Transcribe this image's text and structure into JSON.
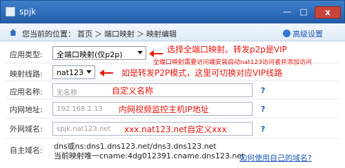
{
  "window": {
    "title": "spjk",
    "min_glyph": "—",
    "max_glyph": "□",
    "close_glyph": "x"
  },
  "pathbar": {
    "prefix": "您当前的位置：",
    "crumbs": [
      "首页",
      "＞",
      "端口映射",
      "＞",
      "映射编辑"
    ],
    "advanced_label": "高级设置"
  },
  "form": {
    "app_type": {
      "label": "应用类型:",
      "value": "全端口映射(仅p2p)",
      "annotation": "选择全端口映射。转发p2p是VIP",
      "hint": "全端口映射需要访问端安装启动nat123访问者并添加访问"
    },
    "line": {
      "label": "映射线路:",
      "value": "nat123",
      "annotation": "如是转发P2P模式，这里可切换对应VIP线路"
    },
    "app_name": {
      "label": "应用名称:",
      "value": "无名称",
      "annotation": "自定义名称",
      "help": "?"
    },
    "intranet_addr": {
      "label": "内网地址:",
      "value": "192.168.1.13",
      "annotation": "内网视频监控主机IP地址",
      "help": "?"
    },
    "extranet_domain": {
      "label": "外网域名:",
      "value": "spjk.nat123.net",
      "annotation": "xxx.nat123.net自定义xxx",
      "help": "?"
    },
    "own_domain": {
      "label": "自主域名:",
      "line1": "dns或ns:dns1.dns123.net/dns3.dns123.net",
      "line2": "当前映射唯一cname:4dg012391.cname.dns123.net",
      "link": "如何使用自己的域名?"
    }
  },
  "colors": {
    "title_bar": "#2e6bb8",
    "annotation_red": "#e8150d",
    "link_blue": "#1c57b8"
  }
}
